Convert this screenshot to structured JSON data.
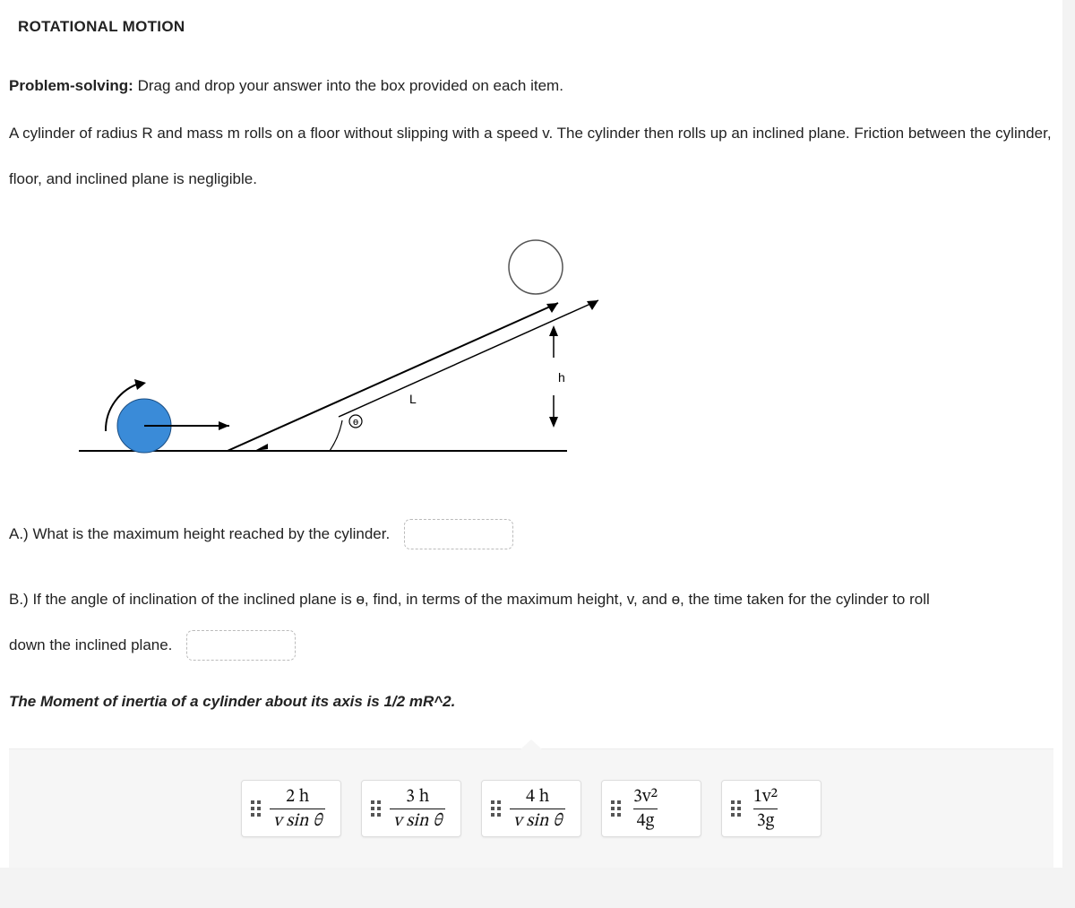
{
  "title": "ROTATIONAL MOTION",
  "intro_label": "Problem-solving:",
  "intro_text": " Drag and drop your answer into the box provided on each item.",
  "problem_text": "A cylinder of radius R and mass m rolls on a floor without slipping with a speed v. The cylinder then rolls up an inclined plane. Friction between the cylinder, floor, and inclined plane is negligible.",
  "diagram": {
    "label_L": "L",
    "label_h": "h",
    "label_theta": "ɵ"
  },
  "q_a": "A.) What is the maximum height reached by the cylinder.",
  "q_b_part1": "B.) If the angle of inclination of the inclined plane is ɵ, find, in terms of the maximum height, v, and ɵ, the time taken for the cylinder to roll",
  "q_b_part2": "down the inclined plane.",
  "hint": "The Moment of inertia of a cylinder about its axis is 1/2 mR^2.",
  "tiles": [
    {
      "num": "2 h",
      "den": "v sin θ"
    },
    {
      "num": "3 h",
      "den": "v sin θ"
    },
    {
      "num": "4 h",
      "den": "v sin θ"
    },
    {
      "num": "3v²",
      "den": "4g"
    },
    {
      "num": "1v²",
      "den": "3g"
    }
  ]
}
